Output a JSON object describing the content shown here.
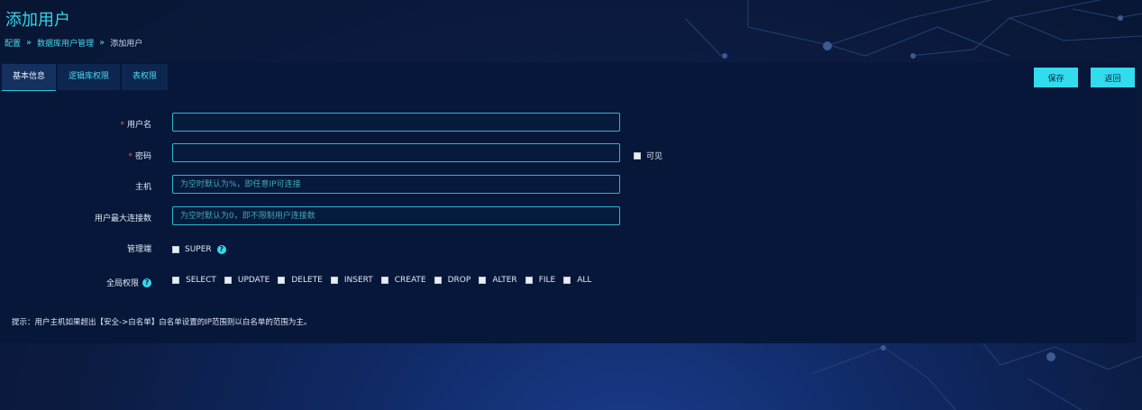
{
  "page": {
    "title": "添加用户",
    "breadcrumb": [
      "配置",
      "数据库用户管理",
      "添加用户"
    ]
  },
  "tabs": [
    "基本信息",
    "逻辑库权限",
    "表权限"
  ],
  "actions": {
    "save": "保存",
    "back": "返回"
  },
  "form": {
    "username": {
      "label": "用户名",
      "value": "",
      "required": true
    },
    "password": {
      "label": "密码",
      "value": "",
      "required": true,
      "visible_label": "可见"
    },
    "host": {
      "label": "主机",
      "placeholder": "为空时默认为%，即任意IP可连接"
    },
    "max_connections": {
      "label": "用户最大连接数",
      "placeholder": "为空时默认为0，即不限制用户连接数"
    },
    "admin": {
      "label": "管理端",
      "option": "SUPER"
    },
    "global_privileges": {
      "label": "全局权限",
      "options": [
        "SELECT",
        "UPDATE",
        "DELETE",
        "INSERT",
        "CREATE",
        "DROP",
        "ALTER",
        "FILE",
        "ALL"
      ]
    }
  },
  "hint": "提示：用户主机如果超出【安全->白名单】白名单设置的IP范围则以白名单的范围为主。",
  "colors": {
    "accent": "#31dcec",
    "panel": "#07173a",
    "required": "#ff4d4f"
  }
}
